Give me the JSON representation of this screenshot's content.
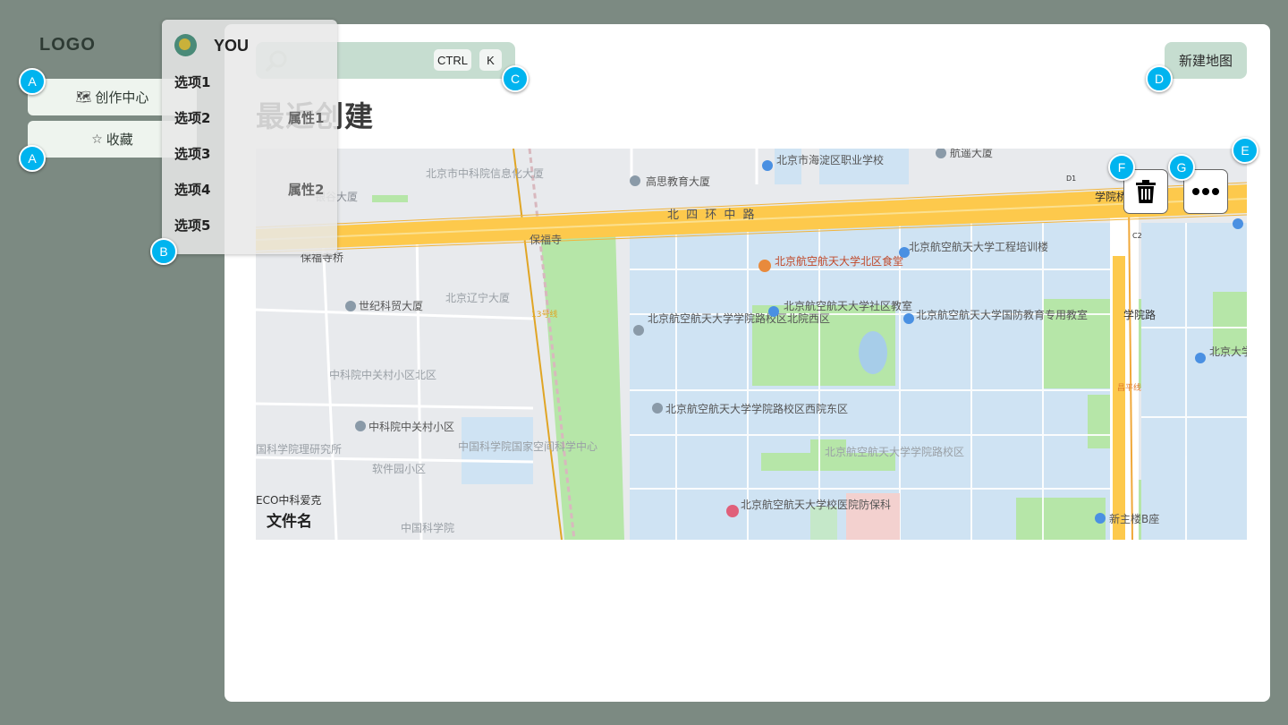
{
  "logo": "LOGO",
  "sidebar": {
    "items": [
      {
        "icon": "map-icon",
        "glyph": "🗺",
        "label": "创作中心"
      },
      {
        "icon": "star-icon",
        "glyph": "☆",
        "label": "收藏"
      }
    ]
  },
  "search": {
    "shortcut_ctrl": "CTRL",
    "shortcut_key": "K"
  },
  "header": {
    "new_map_label": "新建地图"
  },
  "section_title": "最近创建",
  "card": {
    "file_name": "文件名"
  },
  "user_menu": {
    "username": "YOU",
    "options": [
      "选项1",
      "选项2",
      "选项3",
      "选项4",
      "选项5"
    ],
    "properties": [
      "属性1",
      "属性2"
    ]
  },
  "markers": {
    "a": "A",
    "b": "B",
    "c": "C",
    "d": "D",
    "e": "E",
    "f": "F",
    "g": "G"
  },
  "map": {
    "labels": {
      "ring_road": "北 四 环 中 路",
      "baofusi": "保福寺",
      "baofusi_bridge": "保福寺桥",
      "yingu": "银谷大厦",
      "zhongkeyuan_info": "北京市中科院信息化大厦",
      "gaosi": "高思教育大厦",
      "haidian_vocational": "北京市海淀区职业学校",
      "hangyao": "航遥大厦",
      "xueyuanqiao": "学院桥",
      "beihang_north_canteen": "北京航空航天大学北区食堂",
      "beihang_training": "北京航空航天大学工程培训楼",
      "shiji_kemao": "世纪科贸大厦",
      "liaoning": "北京辽宁大厦",
      "beihang_xueyuanlu_north_west": "北京航空航天大学学院路校区北院西区",
      "beihang_community": "北京航空航天大学社区教室",
      "beihang_defense": "北京航空航天大学国防教育专用教室",
      "xueyuanlu": "学院路",
      "zhongguancun_north": "中科院中关村小区北区",
      "zhongguancun_xiaoqu": "中科院中关村小区",
      "beihang_xueyuanlu_east": "北京航空航天大学学院路校区西院东区",
      "beihang_campus": "北京航空航天大学学院路校区",
      "pku_ninth": "北京大学第九教室",
      "cas_space": "中国科学院国家空间科学中心",
      "ruanjianyuan": "软件园小区",
      "cas_physics": "国科学院理研究所",
      "eco": "ECO中科爱克",
      "beihang_hospital": "北京航空航天大学校医院防保科",
      "xinzhulou": "新主楼B座",
      "cas_lower": "中国科学院",
      "changping_line": "昌平线",
      "line13": "13号线",
      "d1": "D1",
      "c2": "C2"
    }
  },
  "colors": {
    "background": "#7c8a82",
    "accent_green": "#c6ddd0",
    "marker_blue": "#00b4ef",
    "road_yellow": "#fdc94c",
    "campus_blue": "#cfe3f3",
    "park_green": "#b6e6a8"
  }
}
